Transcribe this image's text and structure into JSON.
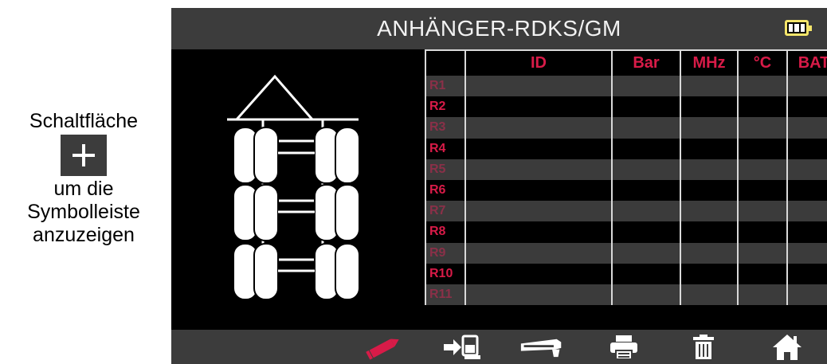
{
  "annotation": {
    "line1": "Schaltfläche",
    "line2": "um die",
    "line3": "Symbolleiste",
    "line4": "anzuzeigen"
  },
  "screen": {
    "title": "ANHÄNGER-RDKS/GM"
  },
  "table": {
    "columns": [
      "",
      "ID",
      "Bar",
      "MHz",
      "°C",
      "BAT"
    ],
    "rows": [
      "R1",
      "R2",
      "R3",
      "R4",
      "R5",
      "R6",
      "R7",
      "R8",
      "R9",
      "R10",
      "R11"
    ]
  },
  "toolbar": {
    "icons": [
      "pencil-icon",
      "transfer-icon",
      "tpms-tool-icon",
      "printer-icon",
      "trash-icon",
      "home-icon"
    ]
  },
  "colors": {
    "accent": "#d81b48",
    "background": "#000000",
    "bar": "#3c3c3c",
    "battery": "#f5e56a"
  }
}
